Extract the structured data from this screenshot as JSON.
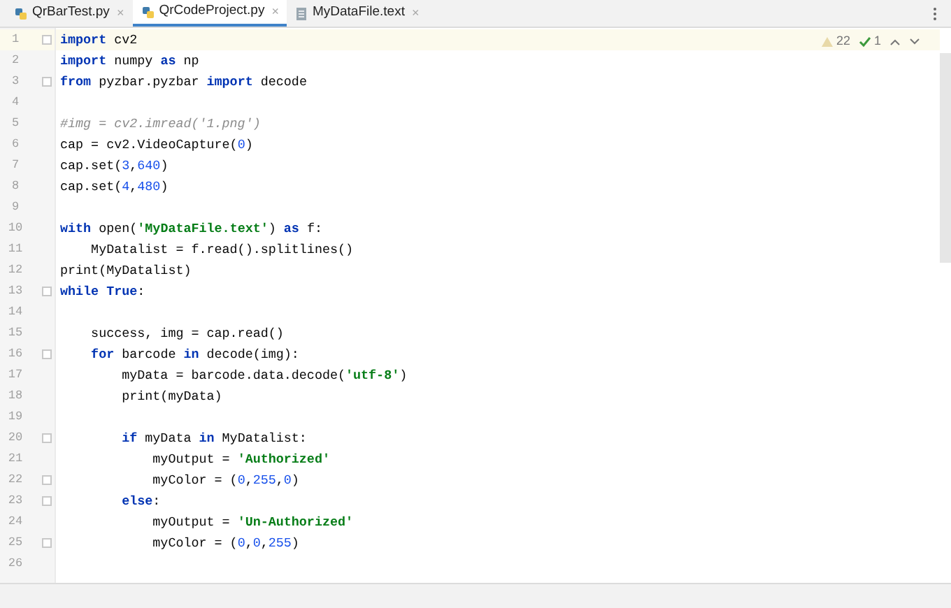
{
  "tabs": [
    {
      "label": "QrBarTest.py",
      "kind": "python",
      "selected": false,
      "close": "×"
    },
    {
      "label": "QrCodeProject.py",
      "kind": "python",
      "selected": true,
      "close": "×"
    },
    {
      "label": "MyDataFile.text",
      "kind": "text",
      "selected": false,
      "close": "×"
    }
  ],
  "inspections": {
    "warnings": "22",
    "checks": "1"
  },
  "lines": [
    {
      "number": "1",
      "current": true,
      "fold": true,
      "tokens": [
        {
          "kind": "kw",
          "text": "import"
        },
        {
          "kind": "plain",
          "text": " cv2"
        }
      ]
    },
    {
      "number": "2",
      "current": false,
      "fold": false,
      "tokens": [
        {
          "kind": "kw",
          "text": "import"
        },
        {
          "kind": "plain",
          "text": " numpy "
        },
        {
          "kind": "kw",
          "text": "as"
        },
        {
          "kind": "plain",
          "text": " np"
        }
      ]
    },
    {
      "number": "3",
      "current": false,
      "fold": true,
      "tokens": [
        {
          "kind": "kw",
          "text": "from"
        },
        {
          "kind": "plain",
          "text": " pyzbar.pyzbar "
        },
        {
          "kind": "kw",
          "text": "import"
        },
        {
          "kind": "plain",
          "text": " decode"
        }
      ]
    },
    {
      "number": "4",
      "current": false,
      "fold": false
    },
    {
      "number": "5",
      "current": false,
      "fold": false,
      "tokens": [
        {
          "kind": "comment",
          "text": "#img = cv2.imread('1.png')"
        }
      ]
    },
    {
      "number": "6",
      "current": false,
      "fold": false,
      "tokens": [
        {
          "kind": "plain",
          "text": "cap = cv2.VideoCapture("
        },
        {
          "kind": "num",
          "text": "0"
        },
        {
          "kind": "plain",
          "text": ")"
        }
      ]
    },
    {
      "number": "7",
      "current": false,
      "fold": false,
      "tokens": [
        {
          "kind": "plain",
          "text": "cap.set("
        },
        {
          "kind": "num",
          "text": "3"
        },
        {
          "kind": "plain",
          "text": ","
        },
        {
          "kind": "num",
          "text": "640"
        },
        {
          "kind": "plain",
          "text": ")"
        }
      ]
    },
    {
      "number": "8",
      "current": false,
      "fold": false,
      "tokens": [
        {
          "kind": "plain",
          "text": "cap.set("
        },
        {
          "kind": "num",
          "text": "4"
        },
        {
          "kind": "plain",
          "text": ","
        },
        {
          "kind": "num",
          "text": "480"
        },
        {
          "kind": "plain",
          "text": ")"
        }
      ]
    },
    {
      "number": "9",
      "current": false,
      "fold": false
    },
    {
      "number": "10",
      "current": false,
      "fold": false,
      "tokens": [
        {
          "kind": "kw",
          "text": "with"
        },
        {
          "kind": "plain",
          "text": " open("
        },
        {
          "kind": "str",
          "text": "'MyDataFile.text'"
        },
        {
          "kind": "plain",
          "text": ") "
        },
        {
          "kind": "kw",
          "text": "as"
        },
        {
          "kind": "plain",
          "text": " f:"
        }
      ]
    },
    {
      "number": "11",
      "current": false,
      "fold": false,
      "tokens": [
        {
          "kind": "plain",
          "text": "    MyDatalist = f.read().splitlines()"
        }
      ]
    },
    {
      "number": "12",
      "current": false,
      "fold": false,
      "tokens": [
        {
          "kind": "plain",
          "text": "print(MyDatalist)"
        }
      ]
    },
    {
      "number": "13",
      "current": false,
      "fold": true,
      "tokens": [
        {
          "kind": "kw",
          "text": "while True"
        },
        {
          "kind": "plain",
          "text": ":"
        }
      ]
    },
    {
      "number": "14",
      "current": false,
      "fold": false
    },
    {
      "number": "15",
      "current": false,
      "fold": false,
      "tokens": [
        {
          "kind": "plain",
          "text": "    success, img = cap.read()"
        }
      ]
    },
    {
      "number": "16",
      "current": false,
      "fold": true,
      "tokens": [
        {
          "kind": "kw",
          "text": "    for"
        },
        {
          "kind": "plain",
          "text": " barcode "
        },
        {
          "kind": "kw",
          "text": "in"
        },
        {
          "kind": "plain",
          "text": " decode(img):"
        }
      ]
    },
    {
      "number": "17",
      "current": false,
      "fold": false,
      "tokens": [
        {
          "kind": "plain",
          "text": "        myData = barcode.data.decode("
        },
        {
          "kind": "str",
          "text": "'utf-8'"
        },
        {
          "kind": "plain",
          "text": ")"
        }
      ]
    },
    {
      "number": "18",
      "current": false,
      "fold": false,
      "tokens": [
        {
          "kind": "plain",
          "text": "        print(myData)"
        }
      ]
    },
    {
      "number": "19",
      "current": false,
      "fold": false
    },
    {
      "number": "20",
      "current": false,
      "fold": true,
      "tokens": [
        {
          "kind": "kw",
          "text": "        if"
        },
        {
          "kind": "plain",
          "text": " myData "
        },
        {
          "kind": "kw",
          "text": "in"
        },
        {
          "kind": "plain",
          "text": " MyDatalist:"
        }
      ]
    },
    {
      "number": "21",
      "current": false,
      "fold": false,
      "tokens": [
        {
          "kind": "plain",
          "text": "            myOutput = "
        },
        {
          "kind": "str",
          "text": "'Authorized'"
        }
      ]
    },
    {
      "number": "22",
      "current": false,
      "fold": true,
      "tokens": [
        {
          "kind": "plain",
          "text": "            myColor = ("
        },
        {
          "kind": "num",
          "text": "0"
        },
        {
          "kind": "plain",
          "text": ","
        },
        {
          "kind": "num",
          "text": "255"
        },
        {
          "kind": "plain",
          "text": ","
        },
        {
          "kind": "num",
          "text": "0"
        },
        {
          "kind": "plain",
          "text": ")"
        }
      ]
    },
    {
      "number": "23",
      "current": false,
      "fold": true,
      "tokens": [
        {
          "kind": "kw",
          "text": "        else"
        },
        {
          "kind": "plain",
          "text": ":"
        }
      ]
    },
    {
      "number": "24",
      "current": false,
      "fold": false,
      "tokens": [
        {
          "kind": "plain",
          "text": "            myOutput = "
        },
        {
          "kind": "str",
          "text": "'Un-Authorized'"
        }
      ]
    },
    {
      "number": "25",
      "current": false,
      "fold": true,
      "tokens": [
        {
          "kind": "plain",
          "text": "            myColor = ("
        },
        {
          "kind": "num",
          "text": "0"
        },
        {
          "kind": "plain",
          "text": ","
        },
        {
          "kind": "num",
          "text": "0"
        },
        {
          "kind": "plain",
          "text": ","
        },
        {
          "kind": "num",
          "text": "255"
        },
        {
          "kind": "plain",
          "text": ")"
        }
      ]
    },
    {
      "number": "26",
      "current": false,
      "fold": false
    }
  ]
}
